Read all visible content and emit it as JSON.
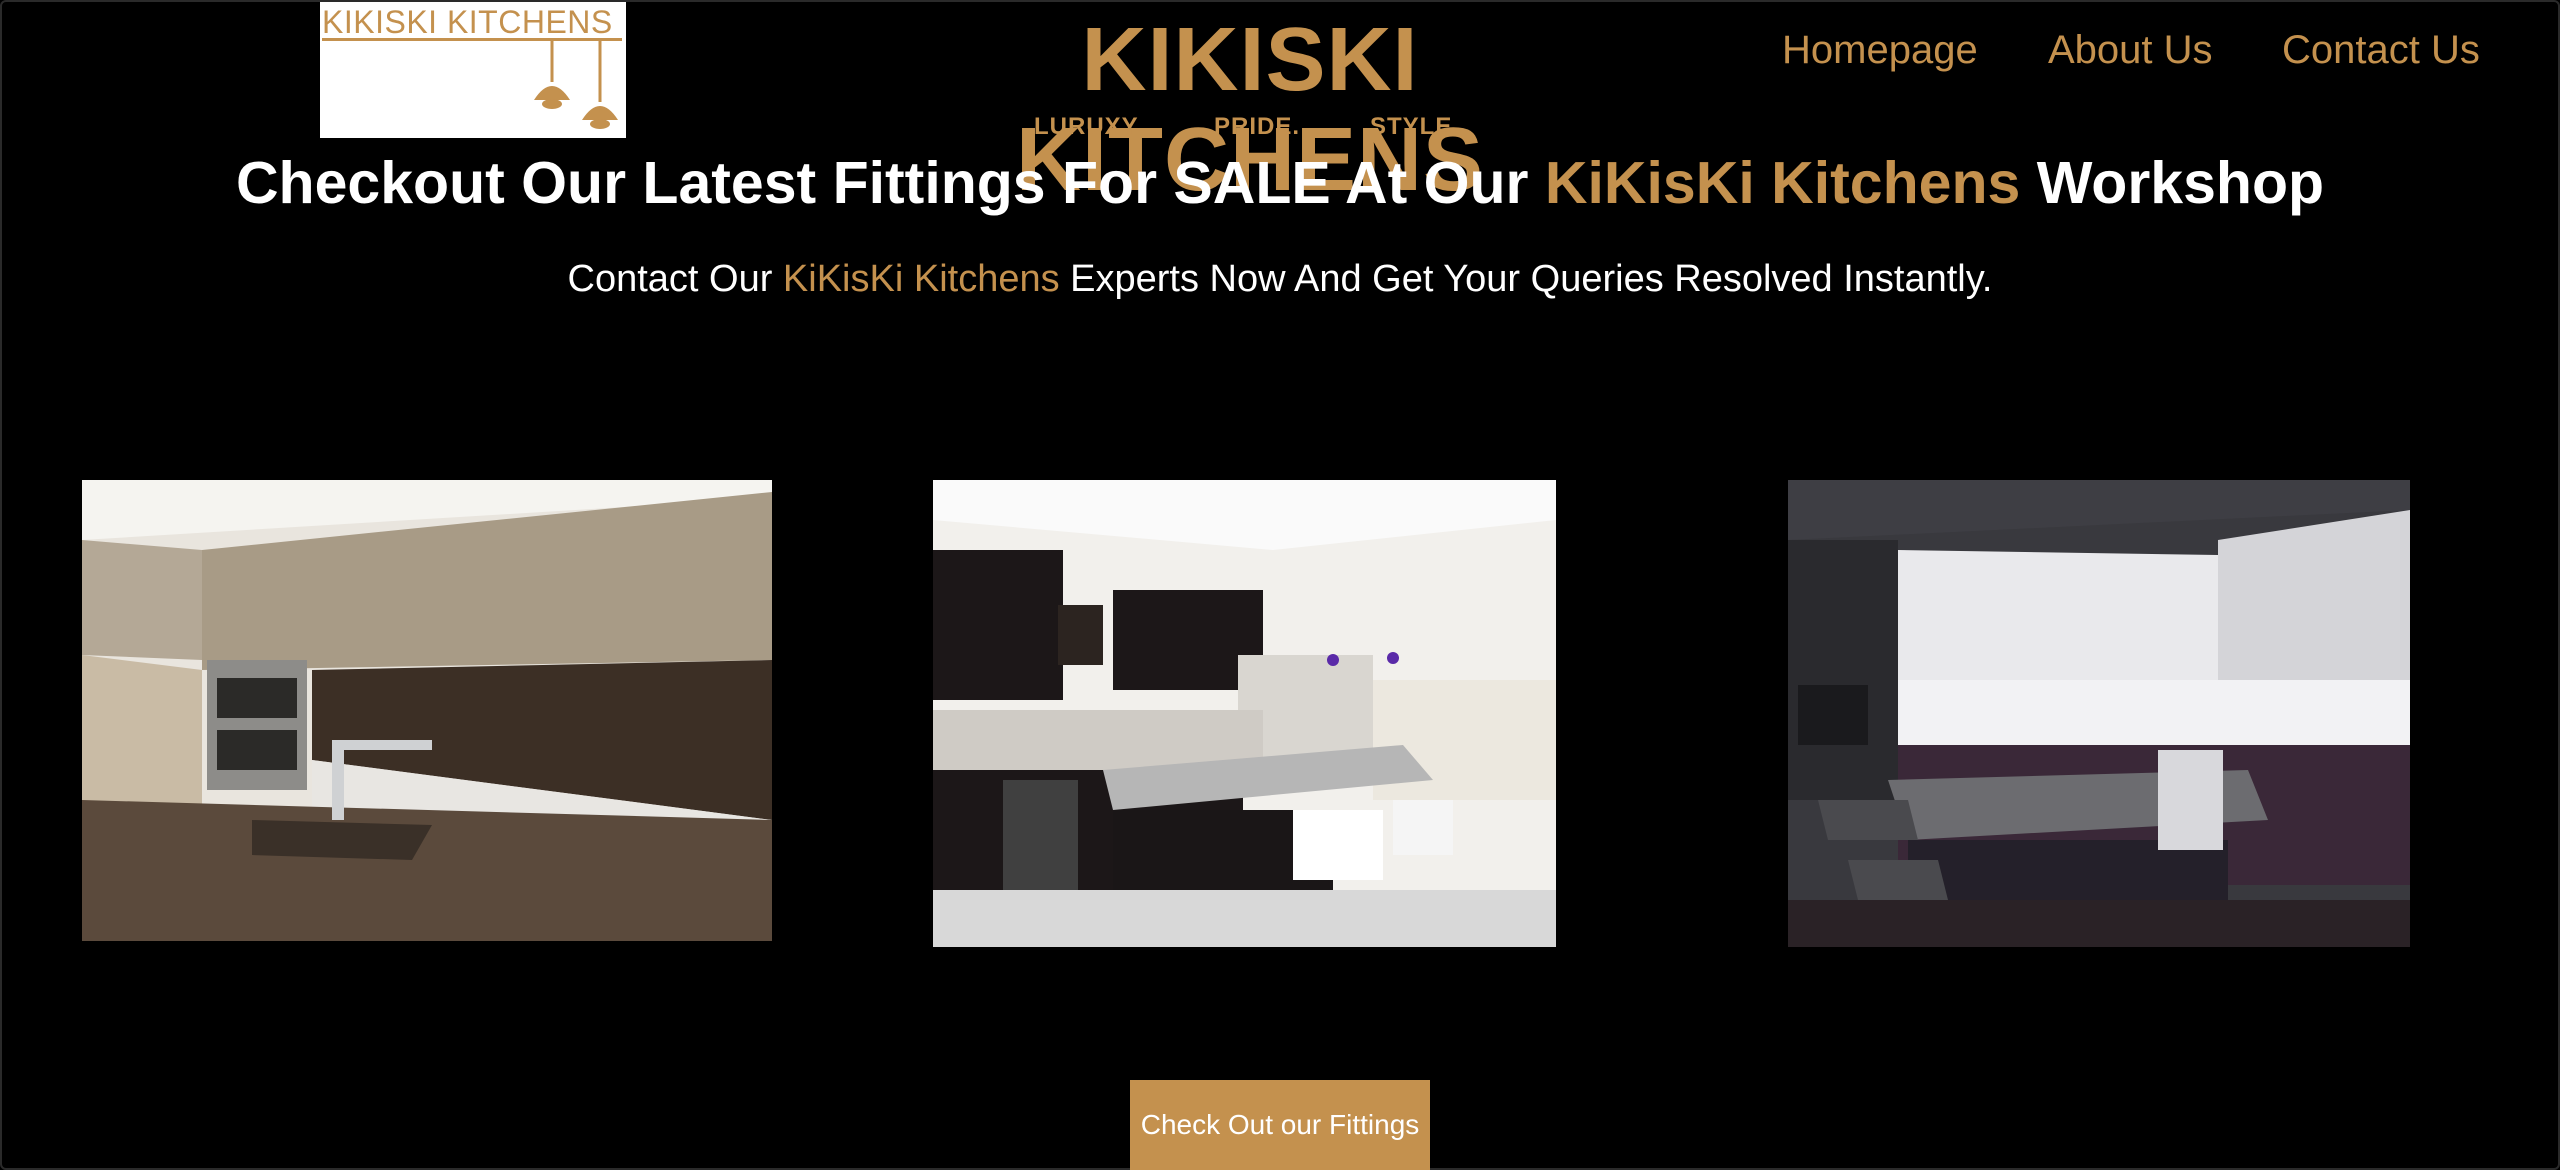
{
  "header": {
    "logo_text": "KIKISKI KITCHENS",
    "brand": "KIKISKI KITCHENS",
    "taglines": [
      "LURUXY.",
      "PRIDE.",
      "STYLE."
    ]
  },
  "nav": {
    "items": [
      "Homepage",
      "About Us",
      "Contact Us"
    ]
  },
  "hero": {
    "headline_before": "Checkout Our Latest Fittings For SALE At Our ",
    "headline_highlight": "KiKisKi Kitchens",
    "headline_after": " Workshop",
    "sub_before": "Contact Our ",
    "sub_highlight": "KiKisKi Kitchens",
    "sub_after": " Experts Now And Get Your Queries Resolved Instantly."
  },
  "gallery": {
    "images": [
      "kitchen-photo-1",
      "kitchen-photo-2",
      "kitchen-photo-3"
    ]
  },
  "cta": {
    "label": "Check Out our Fittings"
  },
  "colors": {
    "accent": "#c4914e",
    "background": "#000000",
    "text": "#ffffff"
  }
}
